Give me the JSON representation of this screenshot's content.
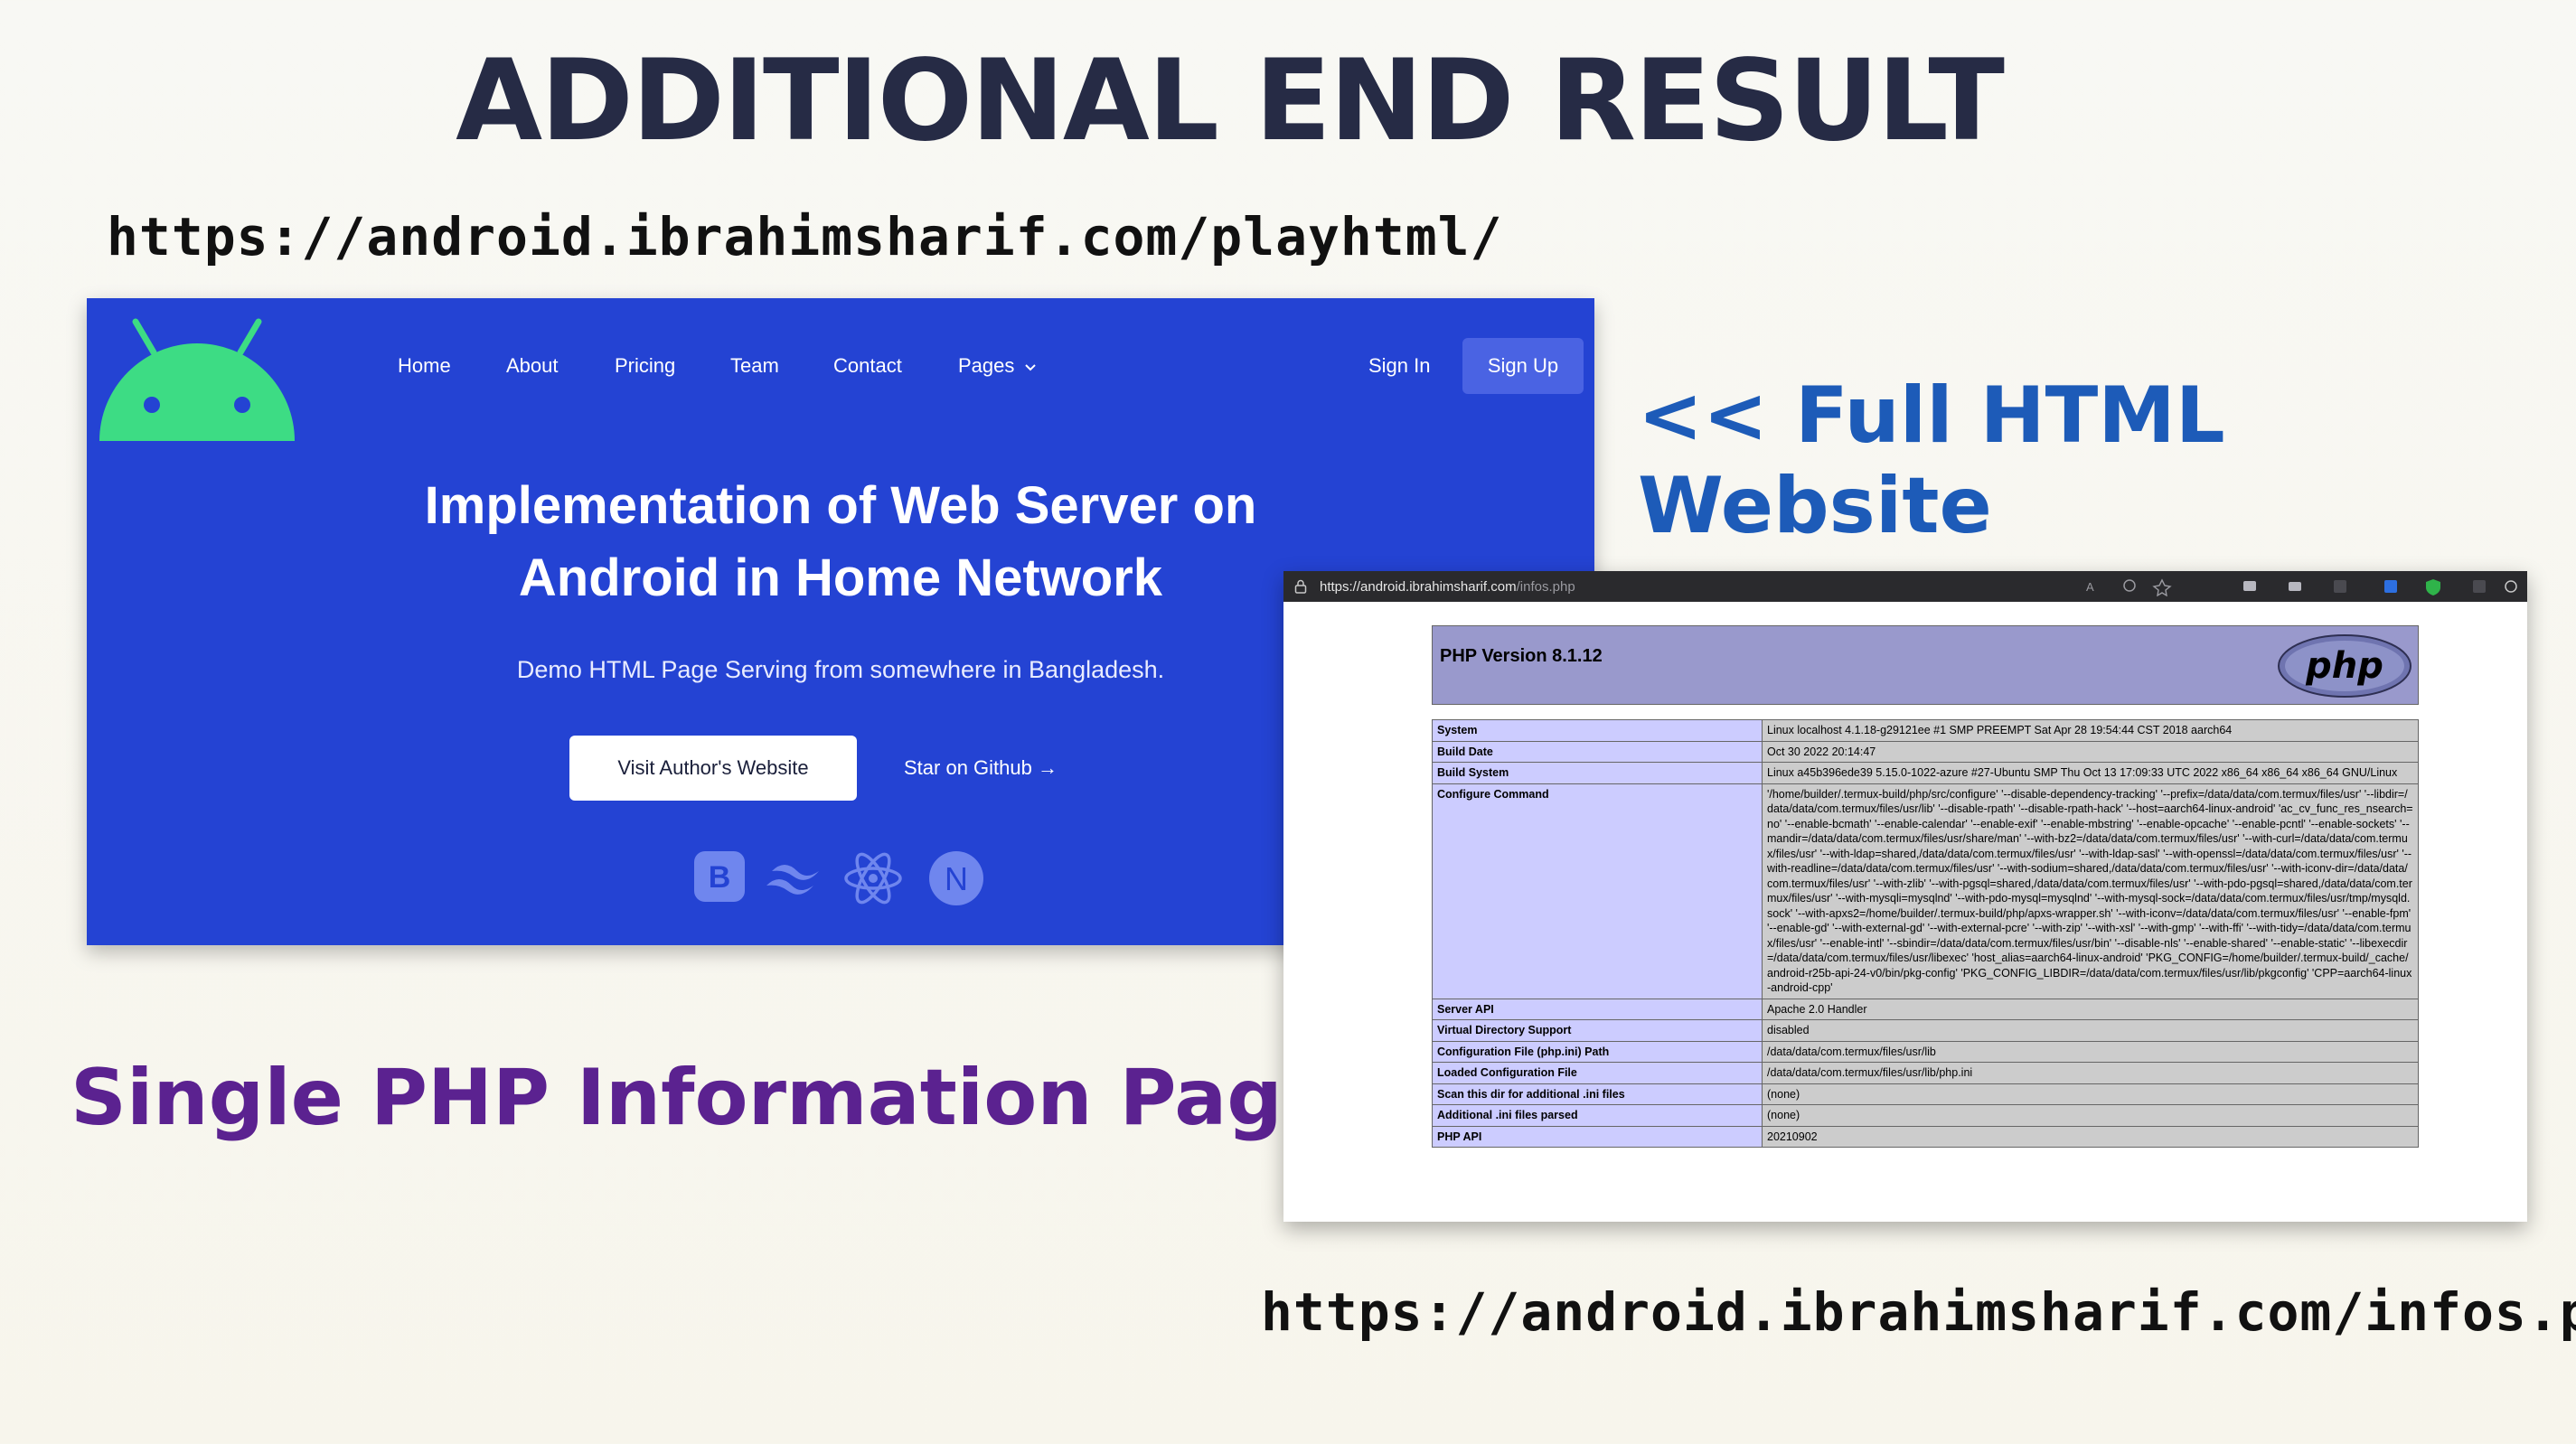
{
  "slide": {
    "title": "ADDITIONAL END RESULT",
    "url_site": "https://android.ibrahimsharif.com/playhtml/",
    "url_php": "https://android.ibrahimsharif.com/infos.php",
    "label_full": "<< Full HTML Website",
    "label_php": "Single PHP Information Page >>"
  },
  "site": {
    "nav": [
      "Home",
      "About",
      "Pricing",
      "Team",
      "Contact",
      "Pages"
    ],
    "signin": "Sign In",
    "signup": "Sign Up",
    "hero_line1": "Implementation of Web Server on",
    "hero_line2": "Android in Home Network",
    "hero_sub": "Demo HTML Page Serving from somewhere in Bangladesh.",
    "visit_button": "Visit Author's Website",
    "star_link": "Star on Github",
    "bootstrap_letter": "B",
    "next_letter": "N"
  },
  "php": {
    "address_host": "https://android.ibrahimsharif.com",
    "address_path": "/infos.php",
    "version": "PHP Version 8.1.12",
    "logo_text": "php",
    "rows": [
      {
        "k": "System",
        "v": "Linux localhost 4.1.18-g29121ee #1 SMP PREEMPT Sat Apr 28 19:54:44 CST 2018 aarch64"
      },
      {
        "k": "Build Date",
        "v": "Oct 30 2022 20:14:47"
      },
      {
        "k": "Build System",
        "v": "Linux a45b396ede39 5.15.0-1022-azure #27-Ubuntu SMP Thu Oct 13 17:09:33 UTC 2022 x86_64 x86_64 x86_64 GNU/Linux"
      },
      {
        "k": "Configure Command",
        "v": "'/home/builder/.termux-build/php/src/configure' '--disable-dependency-tracking' '--prefix=/data/data/com.termux/files/usr' '--libdir=/data/data/com.termux/files/usr/lib' '--disable-rpath' '--disable-rpath-hack' '--host=aarch64-linux-android' 'ac_cv_func_res_nsearch=no' '--enable-bcmath' '--enable-calendar' '--enable-exif' '--enable-mbstring' '--enable-opcache' '--enable-pcntl' '--enable-sockets' '--mandir=/data/data/com.termux/files/usr/share/man' '--with-bz2=/data/data/com.termux/files/usr' '--with-curl=/data/data/com.termux/files/usr' '--with-ldap=shared,/data/data/com.termux/files/usr' '--with-ldap-sasl' '--with-openssl=/data/data/com.termux/files/usr' '--with-readline=/data/data/com.termux/files/usr' '--with-sodium=shared,/data/data/com.termux/files/usr' '--with-iconv-dir=/data/data/com.termux/files/usr' '--with-zlib' '--with-pgsql=shared,/data/data/com.termux/files/usr' '--with-pdo-pgsql=shared,/data/data/com.termux/files/usr' '--with-mysqli=mysqlnd' '--with-pdo-mysql=mysqlnd' '--with-mysql-sock=/data/data/com.termux/files/usr/tmp/mysqld.sock' '--with-apxs2=/home/builder/.termux-build/php/apxs-wrapper.sh' '--with-iconv=/data/data/com.termux/files/usr' '--enable-fpm' '--enable-gd' '--with-external-gd' '--with-external-pcre' '--with-zip' '--with-xsl' '--with-gmp' '--with-ffi' '--with-tidy=/data/data/com.termux/files/usr' '--enable-intl' '--sbindir=/data/data/com.termux/files/usr/bin' '--disable-nls' '--enable-shared' '--enable-static' '--libexecdir=/data/data/com.termux/files/usr/libexec' 'host_alias=aarch64-linux-android' 'PKG_CONFIG=/home/builder/.termux-build/_cache/android-r25b-api-24-v0/bin/pkg-config' 'PKG_CONFIG_LIBDIR=/data/data/com.termux/files/usr/lib/pkgconfig' 'CPP=aarch64-linux-android-cpp'"
      },
      {
        "k": "Server API",
        "v": "Apache 2.0 Handler"
      },
      {
        "k": "Virtual Directory Support",
        "v": "disabled"
      },
      {
        "k": "Configuration File (php.ini) Path",
        "v": "/data/data/com.termux/files/usr/lib"
      },
      {
        "k": "Loaded Configuration File",
        "v": "/data/data/com.termux/files/usr/lib/php.ini"
      },
      {
        "k": "Scan this dir for additional .ini files",
        "v": "(none)"
      },
      {
        "k": "Additional .ini files parsed",
        "v": "(none)"
      },
      {
        "k": "PHP API",
        "v": "20210902"
      }
    ]
  },
  "colors": {
    "site_bg": "#2443d3",
    "android_green": "#3ddc84",
    "php_header": "#9999cc",
    "php_key": "#ccccff",
    "php_value": "#cccccc"
  }
}
